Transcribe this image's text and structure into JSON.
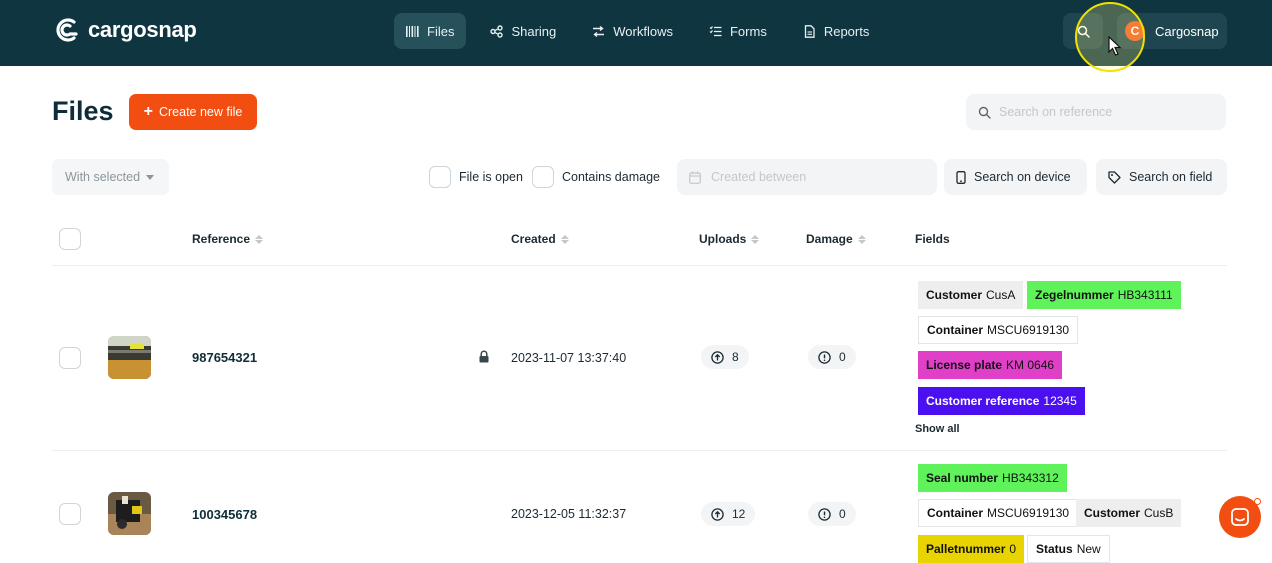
{
  "app": {
    "logo_text": "cargosnap",
    "user_initial": "C",
    "user_name": "Cargosnap"
  },
  "nav": [
    {
      "label": "Files",
      "icon": "barcode-icon",
      "active": true
    },
    {
      "label": "Sharing",
      "icon": "share-icon",
      "active": false
    },
    {
      "label": "Workflows",
      "icon": "workflow-icon",
      "active": false
    },
    {
      "label": "Forms",
      "icon": "checklist-icon",
      "active": false
    },
    {
      "label": "Reports",
      "icon": "document-icon",
      "active": false
    }
  ],
  "page": {
    "title": "Files",
    "create_label": "Create new file",
    "search_placeholder": "Search on reference"
  },
  "filters": {
    "with_selected": "With selected",
    "file_is_open": "File is open",
    "contains_damage": "Contains damage",
    "created_between_placeholder": "Created between",
    "search_on_device": "Search on device",
    "search_on_field": "Search on field"
  },
  "table": {
    "columns": {
      "reference": "Reference",
      "created": "Created",
      "uploads": "Uploads",
      "damage": "Damage",
      "fields": "Fields"
    },
    "show_all": "Show all",
    "rows": [
      {
        "reference": "987654321",
        "locked": true,
        "created": "2023-11-07 13:37:40",
        "uploads": "8",
        "damage": "0",
        "fields": [
          {
            "key": "Customer",
            "value": "CusA",
            "color": "#eeeeee"
          },
          {
            "key": "Zegelnummer",
            "value": "HB343111",
            "color": "#5ff25a"
          },
          {
            "key": "Container",
            "value": "MSCU6919130",
            "color": "#ffffff"
          },
          {
            "key": "License plate",
            "value": "KM 0646",
            "color": "#e040c8"
          },
          {
            "key": "Customer reference",
            "value": "12345",
            "color": "#4a10f0"
          }
        ]
      },
      {
        "reference": "100345678",
        "locked": false,
        "created": "2023-12-05 11:32:37",
        "uploads": "12",
        "damage": "0",
        "fields": [
          {
            "key": "Seal number",
            "value": "HB343312",
            "color": "#5ff25a"
          },
          {
            "key": "Container",
            "value": "MSCU6919130",
            "color": "#ffffff"
          },
          {
            "key": "Customer",
            "value": "CusB",
            "color": "#eeeeee"
          },
          {
            "key": "Palletnummer",
            "value": "0",
            "color": "#e8d400"
          },
          {
            "key": "Status",
            "value": "New",
            "color": "#ffffff"
          }
        ]
      }
    ]
  },
  "colors": {
    "topbar": "#0f3540",
    "accent": "#f24e12"
  }
}
